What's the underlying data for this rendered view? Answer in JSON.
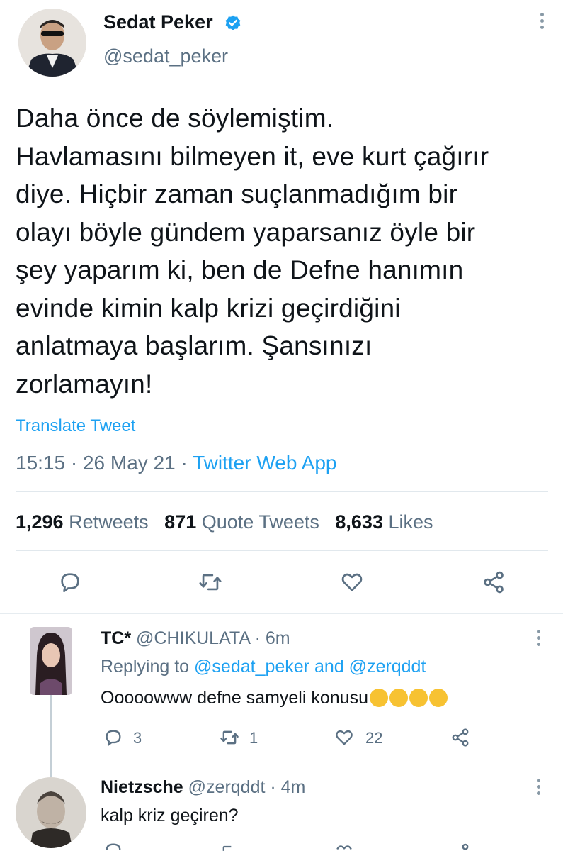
{
  "tweet": {
    "author_name": "Sedat Peker",
    "author_handle": "@sedat_peker",
    "text_lines": [
      "Daha önce de söylemiştim.",
      "Havlamasını bilmeyen it, eve kurt çağırır",
      "diye. Hiçbir zaman suçlanmadığım bir",
      "olayı böyle gündem yaparsanız öyle bir",
      "şey yaparım ki, ben de Defne hanımın",
      "evinde kimin kalp krizi geçirdiğini",
      "anlatmaya başlarım. Şansınızı",
      "zorlamayın!"
    ],
    "translate_label": "Translate Tweet",
    "time": "15:15",
    "date": "26 May 21",
    "source": "Twitter Web App",
    "separator": " · ",
    "retweets_count": "1,296",
    "retweets_label": "Retweets",
    "quotes_count": "871",
    "quotes_label": "Quote Tweets",
    "likes_count": "8,633",
    "likes_label": "Likes"
  },
  "replies": [
    {
      "name": "TC*",
      "handle": "@CHIKULATA",
      "time": "6m",
      "replying_prefix": "Replying to",
      "replying_user1": "@sedat_peker",
      "replying_and": "and",
      "replying_user2": "@zerqddt",
      "text": "Ooooowww defne samyeli konusu",
      "emoji_count": 4,
      "reply_count": "3",
      "retweet_count": "1",
      "like_count": "22"
    },
    {
      "name": "Nietzsche",
      "handle": "@zerqddt",
      "time": "4m",
      "text": "kalp kriz geçiren?"
    }
  ],
  "colors": {
    "accent": "#1da1f2",
    "secondary_text": "#5b7083",
    "primary_text": "#0f1419",
    "divider": "#e1e8ed"
  }
}
